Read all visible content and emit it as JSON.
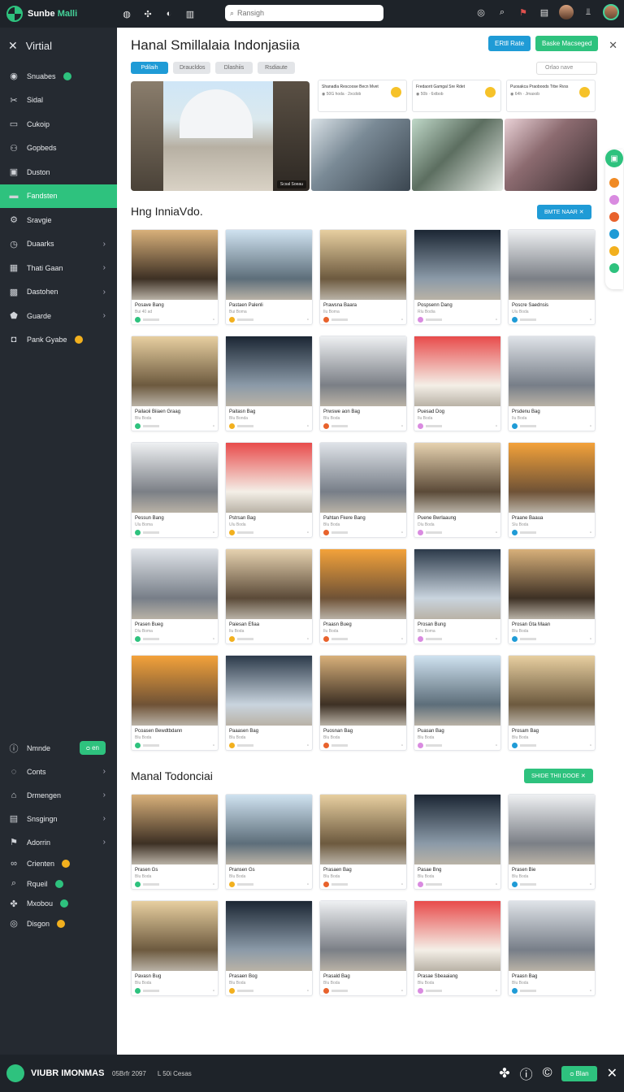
{
  "app": {
    "name_a": "Sunbe",
    "name_b": "Malli"
  },
  "search": {
    "placeholder": "Ransigh"
  },
  "topicons": [
    "compass-icon",
    "tag-icon",
    "flag-icon",
    "chart-icon"
  ],
  "sidebar": {
    "title": "Virtial",
    "items": [
      {
        "label": "Snuabes",
        "icon": "globe-icon",
        "badge": "green",
        "chevron": false
      },
      {
        "label": "Sidal",
        "icon": "tools-icon",
        "badge": "",
        "chevron": false
      },
      {
        "label": "Cukoip",
        "icon": "card-icon",
        "badge": "",
        "chevron": false
      },
      {
        "label": "Gopbeds",
        "icon": "people-icon",
        "badge": "",
        "chevron": false
      },
      {
        "label": "Duston",
        "icon": "doc-icon",
        "badge": "",
        "chevron": false
      },
      {
        "label": "Fandsten",
        "icon": "wallet-icon",
        "badge": "",
        "chevron": false,
        "active": true
      },
      {
        "label": "Sravgie",
        "icon": "gear-icon",
        "badge": "",
        "chevron": false
      },
      {
        "label": "Duaarks",
        "icon": "clock-icon",
        "badge": "",
        "chevron": true
      },
      {
        "label": "Thati Gaan",
        "icon": "grid-icon",
        "badge": "",
        "chevron": true
      },
      {
        "label": "Dastohen",
        "icon": "user-icon",
        "badge": "",
        "chevron": true
      },
      {
        "label": "Guarde",
        "icon": "shield-icon",
        "badge": "",
        "chevron": true
      },
      {
        "label": "Pank Gyabe",
        "icon": "person-icon",
        "badge": "yellow",
        "chevron": false
      }
    ],
    "bottom": [
      {
        "label": "Nmnde",
        "icon": "info-icon",
        "button": "ᴑ en"
      },
      {
        "label": "Conts",
        "icon": "circle-icon",
        "chevron": true
      },
      {
        "label": "Drmengen",
        "icon": "bag-icon",
        "chevron": true
      },
      {
        "label": "Snsgingn",
        "icon": "box-icon",
        "chevron": true
      },
      {
        "label": "Adorrin",
        "icon": "flag-icon",
        "chevron": true
      },
      {
        "label": "Crienten",
        "icon": "link-icon",
        "badge": "yellow"
      },
      {
        "label": "Rqueil",
        "icon": "search-icon",
        "badge": "green"
      },
      {
        "label": "Mxobou",
        "icon": "puzzle-icon",
        "badge": "green"
      },
      {
        "label": "Disgon",
        "icon": "target-icon",
        "badge": "yellow"
      }
    ]
  },
  "header": {
    "title": "Hanal Smillalaia Indonjasiia",
    "btn_blue": "ERtll Rate",
    "btn_green": "Baske Macseged",
    "tabs": [
      "Pdilaih",
      "Draucldos",
      "Dlashiis",
      "Rsdiaute"
    ],
    "select": "Orlao nave"
  },
  "minis": [
    {
      "title": "Shanadla Rescoose Becn Mvet",
      "sub": "◉ 50G hoda · 2xcdob"
    },
    {
      "title": "Fredaorit Gamgal Sre Rdet",
      "sub": "◉ 50b · 6xtbob"
    },
    {
      "title": "Puosakca Praoboods Trbe Rvss",
      "sub": "◉ 64h · Jmaxob"
    }
  ],
  "hero": {
    "pill": "Scsal Soeau"
  },
  "section1": {
    "title": "Hng InniaVdo.",
    "button": "BMTE NAAR ✕"
  },
  "section2": {
    "title": "Manal Todonciai",
    "button": "SHIDE THII DOOE ✕"
  },
  "grid1": [
    {
      "t": "Posave Bang",
      "s": "Bui 40 ad"
    },
    {
      "t": "Pastaen Palenli",
      "s": "Bui Boma"
    },
    {
      "t": "Prawsna Baara",
      "s": "Ilu Boma"
    },
    {
      "t": "Pospsenn Dang",
      "s": "Rlu Bodia"
    },
    {
      "t": "Poscre Saednsis",
      "s": "Ulu Boda"
    },
    {
      "t": "Pailaoii Biiaen Graag",
      "s": "Blu Boda"
    },
    {
      "t": "Paitasn Bag",
      "s": "Blu Bonda"
    },
    {
      "t": "Prwswe aon Bag",
      "s": "Blu Boda"
    },
    {
      "t": "Puesad Dog",
      "s": "Ilu Boda"
    },
    {
      "t": "Prsdenu Bag",
      "s": "Ilu Boda"
    },
    {
      "t": "Pessun Bang",
      "s": "Ulu Boma"
    },
    {
      "t": "Pstrsan Bag",
      "s": "Ulu Boda"
    },
    {
      "t": "Pahtan Fkere Bang",
      "s": "Blu Boda"
    },
    {
      "t": "Puene Bwrlaaung",
      "s": "Dlu Boda"
    },
    {
      "t": "Praane Baaua",
      "s": "Slu Boda"
    },
    {
      "t": "Prasen Bueg",
      "s": "Dlu Boma"
    },
    {
      "t": "Paiesan Efiaa",
      "s": "Ilu Boda"
    },
    {
      "t": "Praasn Bueg",
      "s": "Ilu Boda"
    },
    {
      "t": "Prosan Bung",
      "s": "Blu Boma"
    },
    {
      "t": "Prosan Gta Maan",
      "s": "Blu Boda"
    },
    {
      "t": "Pcoasen Bewdtbdann",
      "s": "Blu Boda"
    },
    {
      "t": "Paaasen Bag",
      "s": "Blu Boda"
    },
    {
      "t": "Puosnan Bag",
      "s": "Blu Boda"
    },
    {
      "t": "Puasan Bag",
      "s": "Blu Boda"
    },
    {
      "t": "Prosam Bag",
      "s": "Blu Boda"
    }
  ],
  "grid2": [
    {
      "t": "Prasen Gs",
      "s": "Blu Boda"
    },
    {
      "t": "Pransen Gs",
      "s": "Blu Boda"
    },
    {
      "t": "Prasaen Bag",
      "s": "Blu Boda"
    },
    {
      "t": "Pasae Bng",
      "s": "Blu Boda"
    },
    {
      "t": "Prasen Bie",
      "s": "Blu Boda"
    },
    {
      "t": "Pavasn Bug",
      "s": "Blu Boda"
    },
    {
      "t": "Prasaen Bog",
      "s": "Blu Boda"
    },
    {
      "t": "Prasald Bag",
      "s": "Blu Boda"
    },
    {
      "t": "Prasae Sbeaaiang",
      "s": "Blu Boda"
    },
    {
      "t": "Praasn Bag",
      "s": "Blu Boda"
    }
  ],
  "footer": {
    "name": "VIUBR IMONMAS",
    "date": "05Brfr 2097",
    "sub": "L 50i Cesas",
    "button": "ᴑ Blan"
  },
  "colors": {
    "accent": "#2ec27e",
    "blue": "#1f9bd6",
    "dark": "#1e2329"
  }
}
